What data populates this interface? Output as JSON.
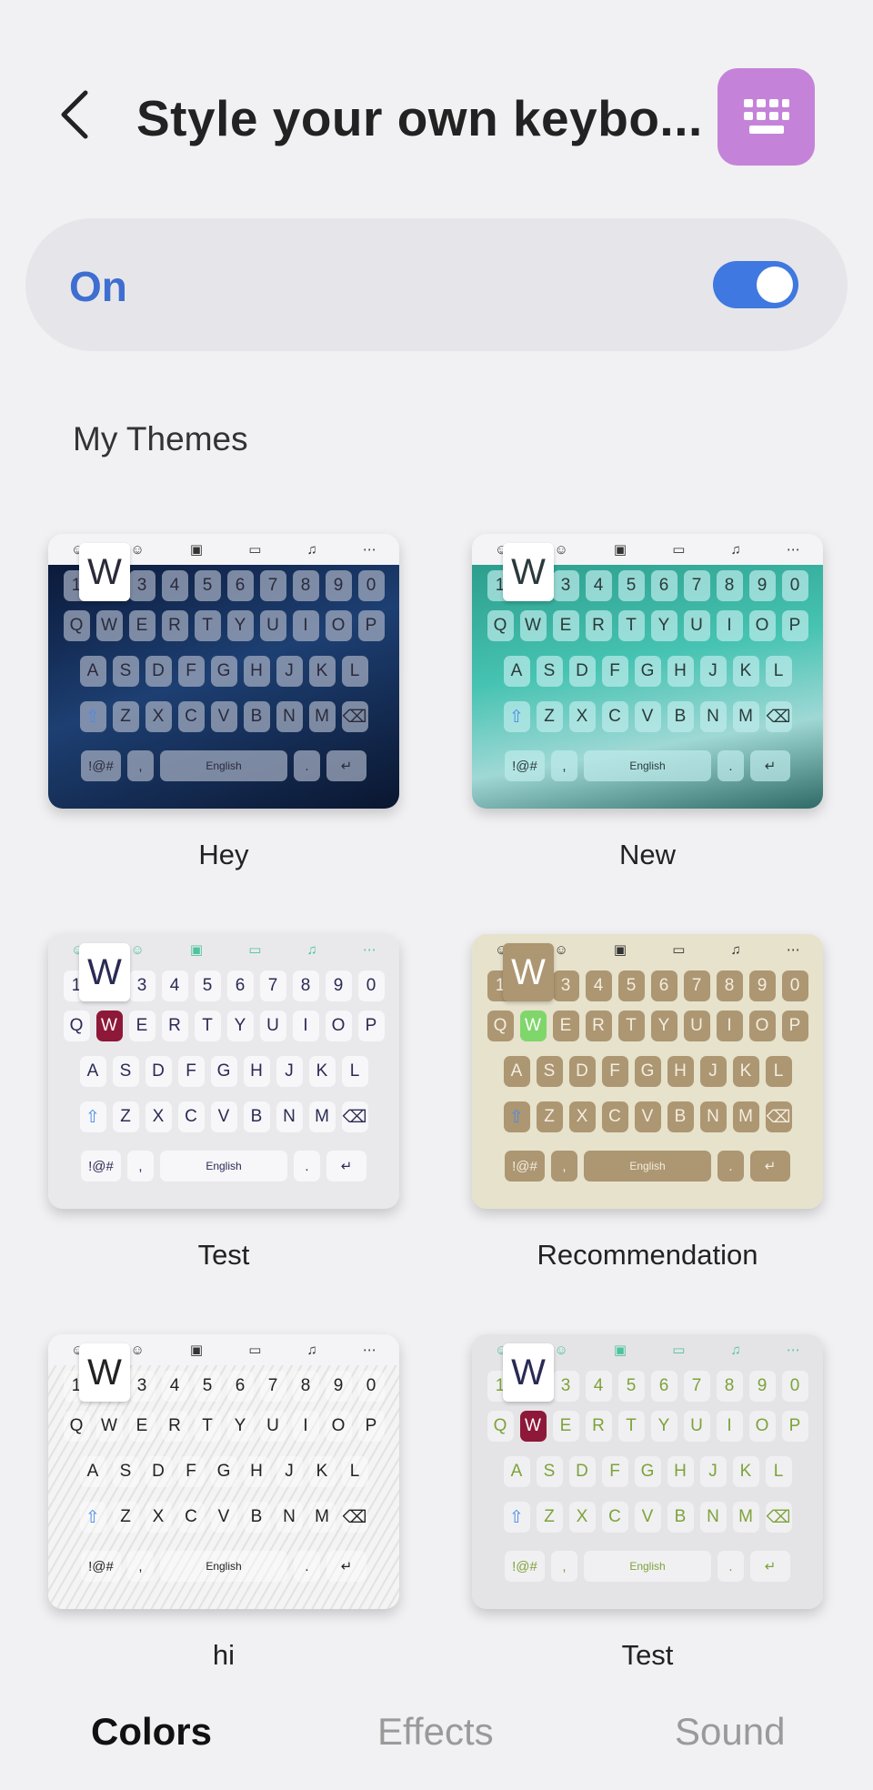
{
  "header": {
    "title": "Style your own keybo..."
  },
  "master_switch": {
    "label": "On",
    "state": "on"
  },
  "section": {
    "title": "My Themes"
  },
  "keyboard_preview": {
    "row1": [
      "1",
      "2",
      "3",
      "4",
      "5",
      "6",
      "7",
      "8",
      "9",
      "0"
    ],
    "row2": [
      "Q",
      "W",
      "E",
      "R",
      "T",
      "Y",
      "U",
      "I",
      "O",
      "P"
    ],
    "row3": [
      "A",
      "S",
      "D",
      "F",
      "G",
      "H",
      "J",
      "K",
      "L"
    ],
    "row4": [
      "Z",
      "X",
      "C",
      "V",
      "B",
      "N",
      "M"
    ],
    "sym": "!@#",
    "comma": ",",
    "space": "English",
    "period": ".",
    "popup_key": "W"
  },
  "themes": [
    {
      "name": "Hey",
      "style": "dark-space"
    },
    {
      "name": "New",
      "style": "teal-aurora"
    },
    {
      "name": "Test",
      "style": "light-burgundy"
    },
    {
      "name": "Recommendation",
      "style": "khaki"
    },
    {
      "name": "hi",
      "style": "white-swirl"
    },
    {
      "name": "Test",
      "style": "light-green"
    }
  ],
  "tabs": [
    {
      "label": "Colors",
      "active": true
    },
    {
      "label": "Effects",
      "active": false
    },
    {
      "label": "Sound",
      "active": false
    }
  ],
  "colors": {
    "accent": "#3f78e0",
    "icon_bg": "#c483d8"
  }
}
